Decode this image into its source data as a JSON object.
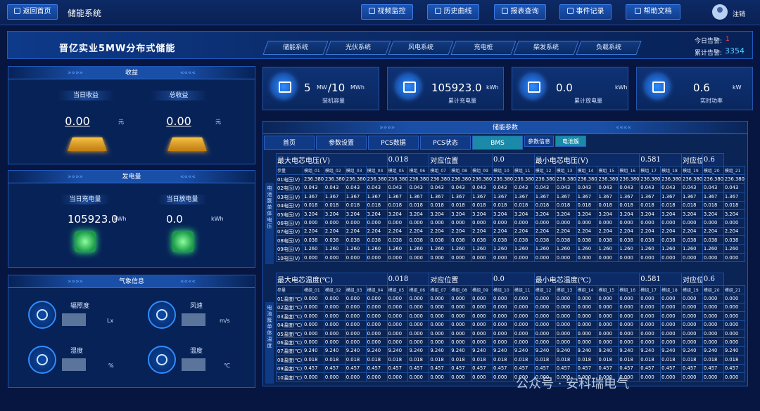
{
  "topbar": {
    "home": "返回首页",
    "title": "储能系统",
    "nav": [
      "视频监控",
      "历史曲线",
      "报表查询",
      "事件记录",
      "帮助文档"
    ],
    "logout": "注销"
  },
  "header": {
    "title": "晋亿实业5MW分布式储能",
    "tabs": [
      "储能系统",
      "光伏系统",
      "风电系统",
      "充电桩",
      "柴发系统",
      "负载系统"
    ]
  },
  "alarms": {
    "today_label": "今日告警:",
    "today": "1",
    "total_label": "累计告警:",
    "total": "3354"
  },
  "income": {
    "title": "收益",
    "day_label": "当日收益",
    "total_label": "总收益",
    "day_value": "0.00",
    "total_value": "0.00",
    "unit": "元"
  },
  "power": {
    "title": "发电量",
    "charge_label": "当日充电量",
    "discharge_label": "当日放电量",
    "charge_value": "105923.0",
    "charge_unit": "kWh",
    "discharge_value": "0.0",
    "discharge_unit": "kWh"
  },
  "weather": {
    "title": "气象信息",
    "items": [
      {
        "label": "辐照度",
        "unit": "Lx"
      },
      {
        "label": "风速",
        "unit": "m/s"
      },
      {
        "label": "湿度",
        "unit": "%"
      },
      {
        "label": "温度",
        "unit": "℃"
      }
    ]
  },
  "kpis": [
    {
      "value": "5",
      "unit": "MW",
      "value2": "/10",
      "unit2": "MWh",
      "label": "装机容量"
    },
    {
      "value": "105923.0",
      "unit": "kWh",
      "label": "累计充电量"
    },
    {
      "value": "0.0",
      "unit": "kWh",
      "label": "累计放电量"
    },
    {
      "value": "0.6",
      "unit": "kW",
      "label": "实时功率"
    }
  ],
  "params": {
    "title": "储能参数",
    "tabs": [
      "首页",
      "参数设置",
      "PCS数据",
      "PCS状态",
      "BMS",
      "参数信息",
      "电池簇"
    ],
    "voltage": {
      "side_label": "电池簇单体电压",
      "max_label": "最大电芯电压(V)",
      "max": "0.018",
      "pos_label": "对应位置",
      "max_pos": "0.0",
      "min_label": "最小电芯电压(V)",
      "min": "0.581",
      "min_pos": "0.6",
      "param_label": "参量",
      "row_suffix": "电压(V)",
      "rows": [
        [
          "236.380",
          "#"
        ],
        [
          "0.043"
        ],
        [
          "1.367"
        ],
        [
          "0.018"
        ],
        [
          "3.204"
        ],
        [
          "0.000"
        ],
        [
          "2.204"
        ],
        [
          "0.038"
        ],
        [
          "1.260"
        ],
        [
          "0.000"
        ]
      ]
    },
    "temperature": {
      "side_label": "电池簇单体温度",
      "max_label": "最大电芯温度(℃)",
      "max": "0.018",
      "pos_label": "对应位置",
      "max_pos": "0.0",
      "min_label": "最小电芯温度(℃)",
      "min": "0.581",
      "min_pos": "0.6",
      "param_label": "参量",
      "row_suffix": "温度(℃)",
      "rows": [
        [
          "0.000"
        ],
        [
          "0.000"
        ],
        [
          "0.000"
        ],
        [
          "0.000"
        ],
        [
          "0.000"
        ],
        [
          "0.000"
        ],
        [
          "9.240"
        ],
        [
          "0.018"
        ],
        [
          "0.457"
        ],
        [
          "0.000"
        ]
      ]
    },
    "module_prefix": "模组_"
  },
  "watermark": "公众号 · 安科瑞电气"
}
